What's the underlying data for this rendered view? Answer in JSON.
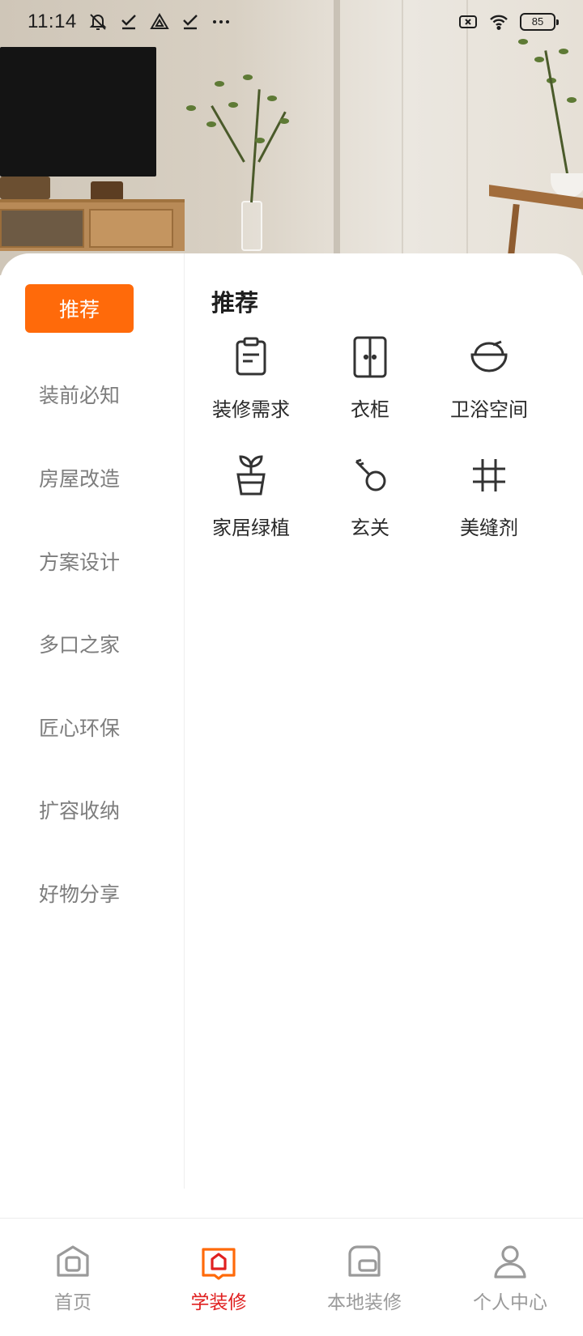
{
  "status_bar": {
    "time": "11:14",
    "battery": "85",
    "left_icons": [
      "mute-icon",
      "check-icon",
      "drive-icon",
      "check-icon",
      "more-icon"
    ],
    "right_icons": [
      "no-sim-icon",
      "wifi-icon",
      "battery-icon"
    ]
  },
  "sidebar": {
    "active_color": "#ff6a0a",
    "items": [
      {
        "label": "推荐",
        "active": true
      },
      {
        "label": "装前必知",
        "active": false
      },
      {
        "label": "房屋改造",
        "active": false
      },
      {
        "label": "方案设计",
        "active": false
      },
      {
        "label": "多口之家",
        "active": false
      },
      {
        "label": "匠心环保",
        "active": false
      },
      {
        "label": "扩容收纳",
        "active": false
      },
      {
        "label": "好物分享",
        "active": false
      }
    ]
  },
  "content": {
    "title": "推荐",
    "items": [
      {
        "label": "装修需求",
        "icon": "clipboard-icon"
      },
      {
        "label": "衣柜",
        "icon": "wardrobe-icon"
      },
      {
        "label": "卫浴空间",
        "icon": "bathtub-icon"
      },
      {
        "label": "家居绿植",
        "icon": "plant-icon"
      },
      {
        "label": "玄关",
        "icon": "key-icon"
      },
      {
        "label": "美缝剂",
        "icon": "grid-icon"
      }
    ]
  },
  "bottom_nav": {
    "active_color": "#e02020",
    "items": [
      {
        "label": "首页",
        "icon": "home-icon",
        "active": false
      },
      {
        "label": "学装修",
        "icon": "book-icon",
        "active": true
      },
      {
        "label": "本地装修",
        "icon": "local-icon",
        "active": false
      },
      {
        "label": "个人中心",
        "icon": "profile-icon",
        "active": false
      }
    ]
  }
}
